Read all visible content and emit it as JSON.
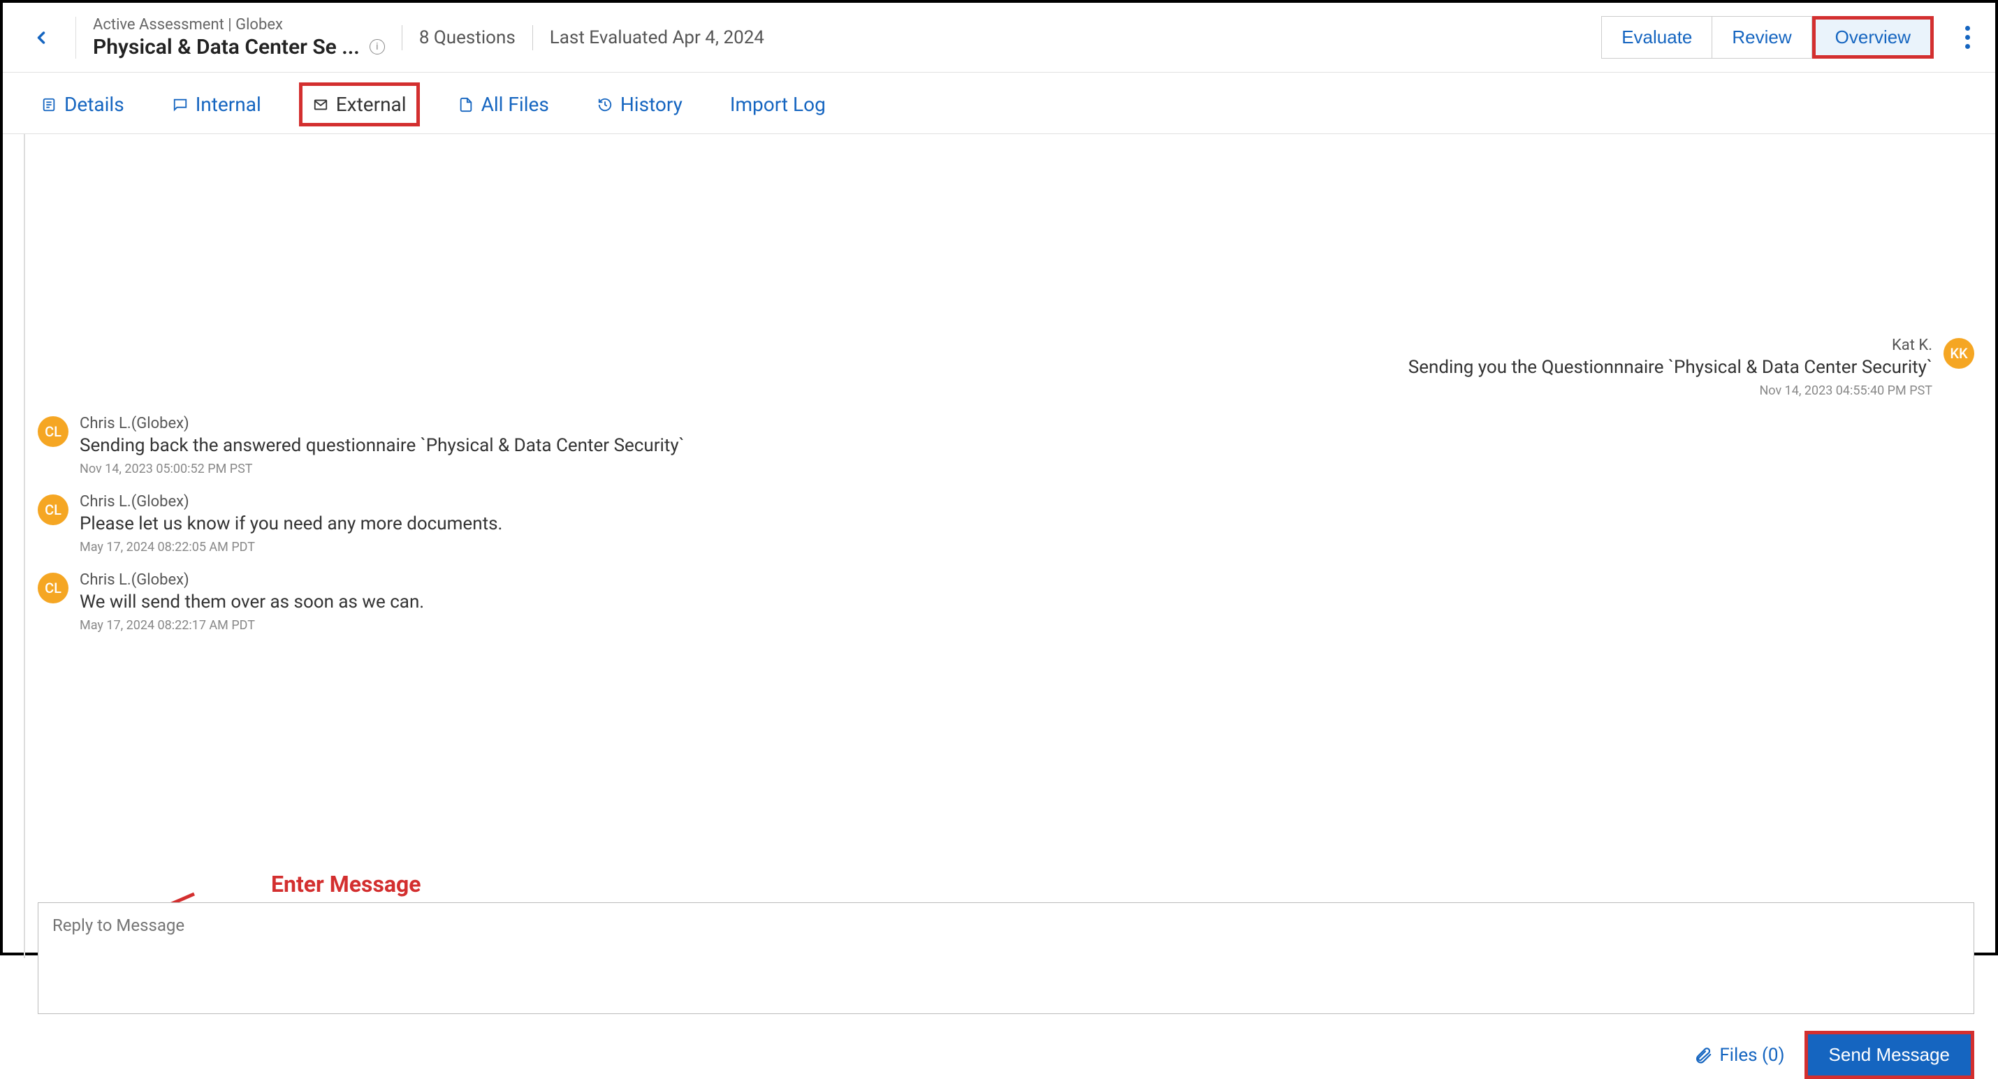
{
  "header": {
    "breadcrumb": "Active Assessment | Globex",
    "title": "Physical & Data Center Se ...",
    "questions": "8 Questions",
    "last_eval": "Last Evaluated Apr 4, 2024",
    "buttons": {
      "evaluate": "Evaluate",
      "review": "Review",
      "overview": "Overview"
    }
  },
  "tabs": {
    "details": "Details",
    "internal": "Internal",
    "external": "External",
    "all_files": "All Files",
    "history": "History",
    "import_log": "Import Log"
  },
  "messages": [
    {
      "side": "right",
      "sender": "Kat K.",
      "initials": "KK",
      "body": "Sending you the Questionnnaire `Physical & Data Center Security`",
      "ts": "Nov 14, 2023 04:55:40 PM PST"
    },
    {
      "side": "left",
      "sender": "Chris L.(Globex)",
      "initials": "CL",
      "body": "Sending back the answered questionnaire `Physical & Data Center Security`",
      "ts": "Nov 14, 2023 05:00:52 PM PST"
    },
    {
      "side": "left",
      "sender": "Chris L.(Globex)",
      "initials": "CL",
      "body": "Please let us know if you need any more documents.",
      "ts": "May 17, 2024 08:22:05 AM PDT"
    },
    {
      "side": "left",
      "sender": "Chris L.(Globex)",
      "initials": "CL",
      "body": "We will send them over as soon as we can.",
      "ts": "May 17, 2024 08:22:17 AM PDT"
    }
  ],
  "annotation": "Enter Message",
  "reply": {
    "placeholder": "Reply to Message",
    "files_label": "Files (0)",
    "send_label": "Send Message"
  }
}
